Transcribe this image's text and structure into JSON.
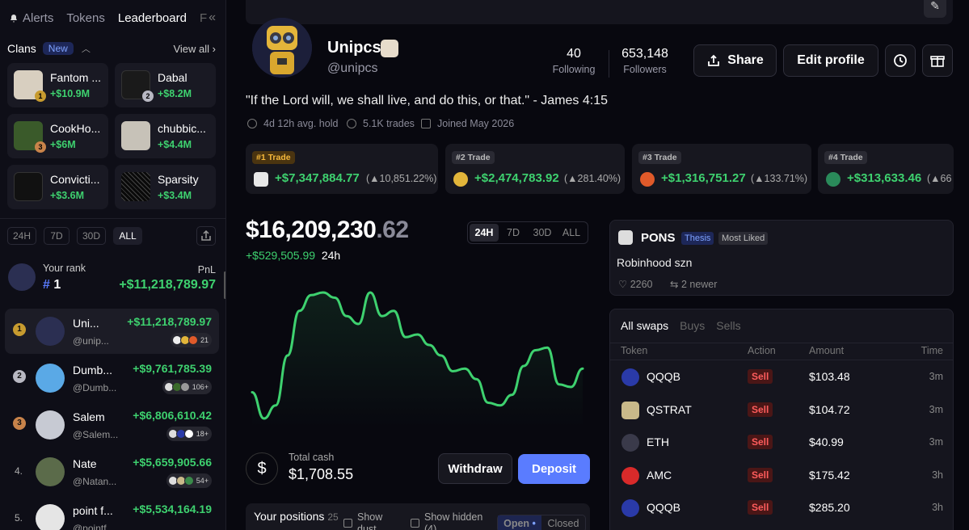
{
  "sidebar": {
    "tabs": [
      "Alerts",
      "Tokens",
      "Leaderboard",
      "F"
    ],
    "clans_label": "Clans",
    "new_badge": "New",
    "view_all": "View all",
    "clans": [
      {
        "name": "Fantom ...",
        "amount": "+$10.9M",
        "color": "#d8cfc0"
      },
      {
        "name": "Dabal",
        "amount": "+$8.2M",
        "color": "#1a1a1a"
      },
      {
        "name": "CookHo...",
        "amount": "+$6M",
        "color": "#3a5a2a"
      },
      {
        "name": "chubbic...",
        "amount": "+$4.4M",
        "color": "#c7c2b8"
      },
      {
        "name": "Convicti...",
        "amount": "+$3.6M",
        "color": "#111111"
      },
      {
        "name": "Sparsity",
        "amount": "+$3.4M",
        "color": "#0a0a0a"
      }
    ],
    "periods": [
      "24H",
      "7D",
      "30D",
      "ALL"
    ],
    "your_rank_label": "Your rank",
    "pnl_label": "PnL",
    "your_rank": "1",
    "your_pnl": "+$11,218,789.97",
    "leaderboard": [
      {
        "pos": "1",
        "name": "Uni...",
        "handle": "@unip...",
        "pnl": "+$11,218,789.97",
        "count": "21",
        "medal": "#c79b2f",
        "avatar": "#2b2f52"
      },
      {
        "pos": "2",
        "name": "Dumb...",
        "handle": "@Dumb...",
        "pnl": "+$9,761,785.39",
        "count": "106+",
        "medal": "#b8b8c2",
        "avatar": "#5aa9e6"
      },
      {
        "pos": "3",
        "name": "Salem",
        "handle": "@Salem...",
        "pnl": "+$6,806,610.42",
        "count": "18+",
        "medal": "#c8834a",
        "avatar": "#c7cad3"
      },
      {
        "pos": "4.",
        "name": "Nate",
        "handle": "@Natan...",
        "pnl": "+$5,659,905.66",
        "count": "54+",
        "medal": "",
        "avatar": "#5b6b4a"
      },
      {
        "pos": "5.",
        "name": "point f...",
        "handle": "@pointf...",
        "pnl": "+$5,534,164.19",
        "count": "",
        "medal": "",
        "avatar": "#e5e5e5"
      }
    ]
  },
  "profile": {
    "name": "Unipcs",
    "handle": "@unipcs",
    "following": "40",
    "following_label": "Following",
    "followers": "653,148",
    "followers_label": "Followers",
    "share": "Share",
    "edit": "Edit profile",
    "quote": "\"If the Lord will, we shall live, and do this, or that.\" - James 4:15",
    "hold": "4d 12h avg. hold",
    "trades": "5.1K trades",
    "joined": "Joined May 2026"
  },
  "top_trades": [
    {
      "tag": "#1 Trade",
      "amount": "+$7,347,884.77",
      "pct": "▲10,851.22%)",
      "color": "#e8e8e8"
    },
    {
      "tag": "#2 Trade",
      "amount": "+$2,474,783.92",
      "pct": "▲281.40%)",
      "color": "#e2b53a"
    },
    {
      "tag": "#3 Trade",
      "amount": "+$1,316,751.27",
      "pct": "▲133.71%)",
      "color": "#e05a2a"
    },
    {
      "tag": "#4 Trade",
      "amount": "+$313,633.46",
      "pct": "▲66",
      "color": "#2a8a5a"
    }
  ],
  "portfolio": {
    "value_main": "$16,209,230",
    "value_dec": ".62",
    "delta": "+$529,505.99",
    "delta_period": "24h",
    "periods": [
      "24H",
      "7D",
      "30D",
      "ALL"
    ],
    "total_cash_label": "Total cash",
    "total_cash": "$1,708.55",
    "withdraw": "Withdraw",
    "deposit": "Deposit",
    "positions_title": "Your positions",
    "positions_count": "25",
    "show_dust": "Show dust",
    "show_hidden": "Show hidden (4)",
    "open": "Open",
    "closed": "Closed"
  },
  "chart_data": {
    "type": "line",
    "period": "24h",
    "values": [
      31,
      21,
      26,
      45,
      62,
      68,
      69,
      67,
      60,
      57,
      69,
      60,
      62,
      52,
      53,
      49,
      45,
      39,
      40,
      36,
      27,
      26,
      30,
      41,
      47,
      48,
      34,
      33,
      40
    ]
  },
  "post": {
    "name": "PONS",
    "badge1": "Thesis",
    "badge2": "Most Liked",
    "text": "Robinhood szn",
    "likes": "2260",
    "newer": "2 newer"
  },
  "swaps": {
    "tabs": [
      "All swaps",
      "Buys",
      "Sells"
    ],
    "headers": [
      "Token",
      "Action",
      "Amount",
      "Time"
    ],
    "rows": [
      {
        "token": "QQQB",
        "action": "Sell",
        "amount": "$103.48",
        "time": "3m",
        "color": "#2a3aa8"
      },
      {
        "token": "QSTRAT",
        "action": "Sell",
        "amount": "$104.72",
        "time": "3m",
        "color": "#c9b98a"
      },
      {
        "token": "ETH",
        "action": "Sell",
        "amount": "$40.99",
        "time": "3m",
        "color": "#3a3a4a"
      },
      {
        "token": "AMC",
        "action": "Sell",
        "amount": "$175.42",
        "time": "3h",
        "color": "#d92a2a"
      },
      {
        "token": "QQQB",
        "action": "Sell",
        "amount": "$285.20",
        "time": "3h",
        "color": "#2a3aa8"
      }
    ]
  }
}
